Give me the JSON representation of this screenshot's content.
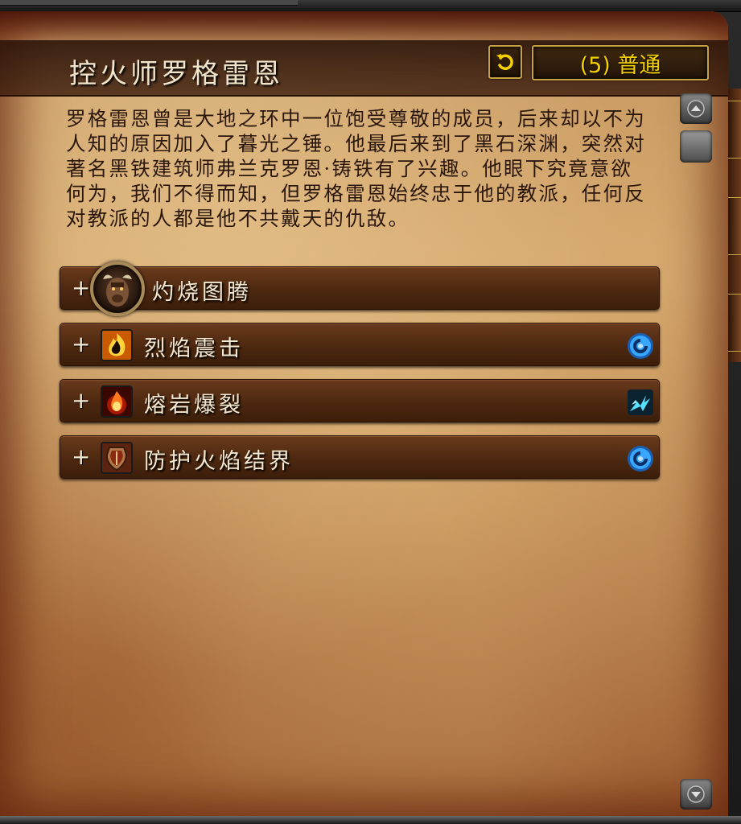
{
  "header": {
    "title": "控火师罗格雷恩",
    "reset_icon": "reset-arrow-icon",
    "difficulty_label": "(5) 普通"
  },
  "description": "罗格雷恩曾是大地之环中一位饱受尊敬的成员，后来却以不为人知的原因加入了暮光之锤。他最后来到了黑石深渊，突然对著名黑铁建筑师弗兰克罗恩·铸铁有了兴趣。他眼下究竟意欲何为，我们不得而知，但罗格雷恩始终忠于他的教派，任何反对教派的人都是他不共戴天的仇敌。",
  "abilities": [
    {
      "expand": "+",
      "name": "灼烧图腾",
      "icon": "totem-portrait-icon",
      "role_icon": ""
    },
    {
      "expand": "+",
      "name": "烈焰震击",
      "icon": "flame-shock-icon",
      "role_icon": "interruptible-icon"
    },
    {
      "expand": "+",
      "name": "熔岩爆裂",
      "icon": "lava-burst-icon",
      "role_icon": "magic-dispel-icon"
    },
    {
      "expand": "+",
      "name": "防护火焰结界",
      "icon": "fire-ward-shield-icon",
      "role_icon": "interruptible-icon"
    }
  ],
  "colors": {
    "parchment": "#c99a5e",
    "title_text": "#f1e6cc",
    "difficulty_text": "#f5d000",
    "row_bg": "#4d2810",
    "frame_gold": "#c9a240",
    "role_blue": "#2a8fe0"
  }
}
